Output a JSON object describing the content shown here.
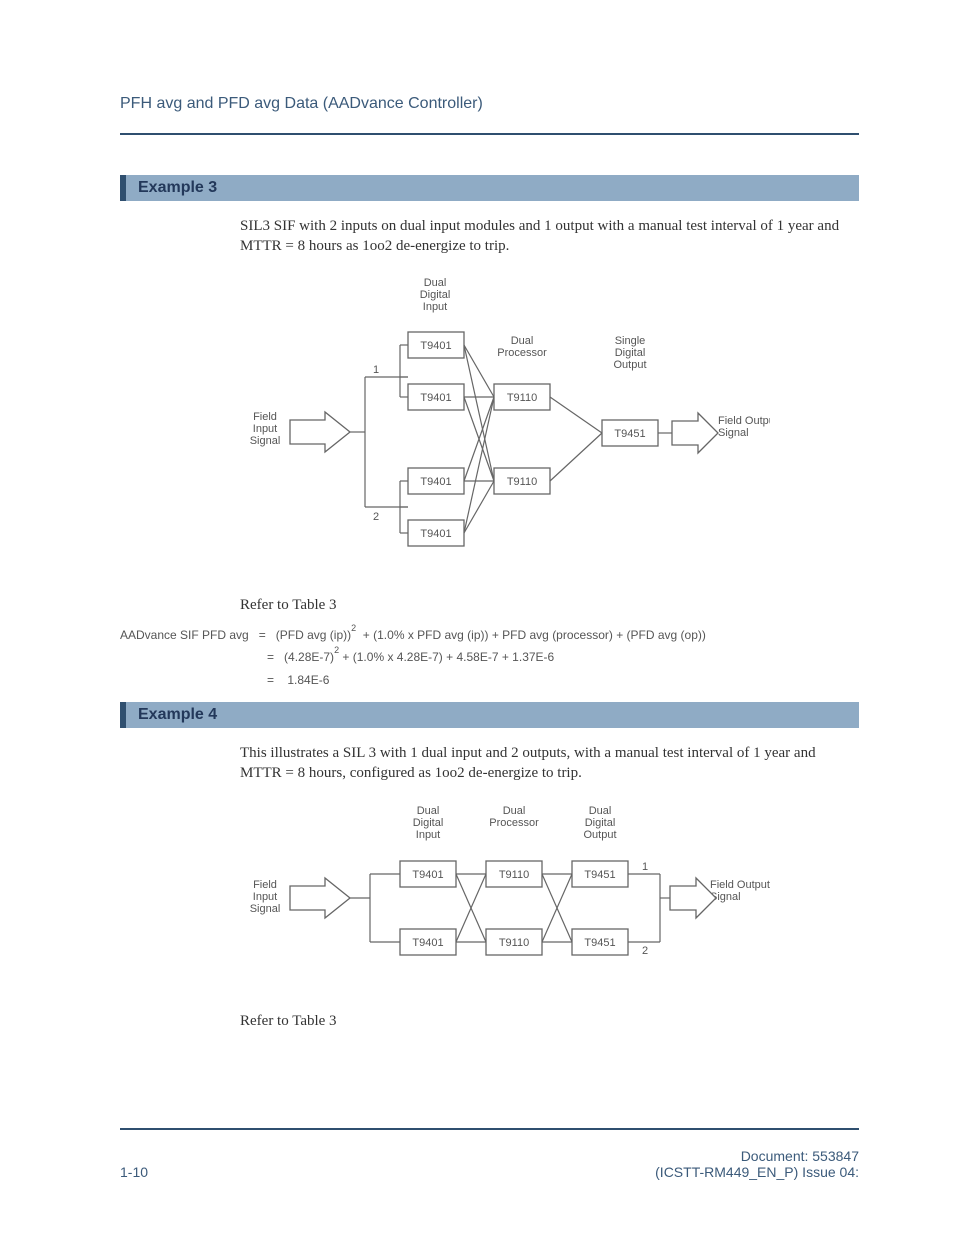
{
  "header": {
    "title": "PFH avg and PFD avg Data   (AADvance Controller)"
  },
  "example3": {
    "heading": "Example 3",
    "body": "SIL3 SIF with 2 inputs on dual input modules and 1 output with a manual test interval of 1 year and MTTR = 8 hours as 1oo2 de-energize to trip.",
    "refer": "Refer to Table 3",
    "diagram": {
      "dual_digital_input": "Dual\nDigital\nInput",
      "dual_processor": "Dual\nProcessor",
      "single_digital_output": "Single\nDigital\nOutput",
      "field_input_signal": "Field\nInput\nSignal",
      "field_output_signal": "Field Output\nSignal",
      "n1": "1",
      "n2": "2",
      "b_t9401": "T9401",
      "b_t9110": "T9110",
      "b_t9451": "T9451"
    },
    "formula": {
      "lhs": "AADvance SIF PFD avg",
      "eq": "=",
      "line1a": "(PFD avg (ip))",
      "line1b": "+  (1.0% x PFD avg (ip)) +  PFD avg (processor)  + (PFD avg (op))",
      "line2a": "(4.28E-7)",
      "line2b": "+ (1.0% x 4.28E-7) + 4.58E-7 + 1.37E-6",
      "line3": "1.84E-6",
      "exp": "2"
    }
  },
  "example4": {
    "heading": "Example 4",
    "body": "This illustrates a SIL 3 with 1 dual input and 2 outputs, with a manual test interval of 1 year and MTTR = 8 hours, configured as 1oo2 de-energize to trip.",
    "refer": "Refer to Table 3",
    "diagram": {
      "dual_digital_input": "Dual\nDigital\nInput",
      "dual_processor": "Dual\nProcessor",
      "dual_digital_output": "Dual\nDigital\nOutput",
      "field_input_signal": "Field\nInput\nSignal",
      "field_output_signal": "Field Output\nSignal",
      "n1": "1",
      "n2": "2",
      "b_t9401": "T9401",
      "b_t9110": "T9110",
      "b_t9451": "T9451"
    }
  },
  "footer": {
    "page": "1-10",
    "doc_line1": "Document: 553847",
    "doc_line2": "(ICSTT-RM449_EN_P) Issue 04:"
  }
}
